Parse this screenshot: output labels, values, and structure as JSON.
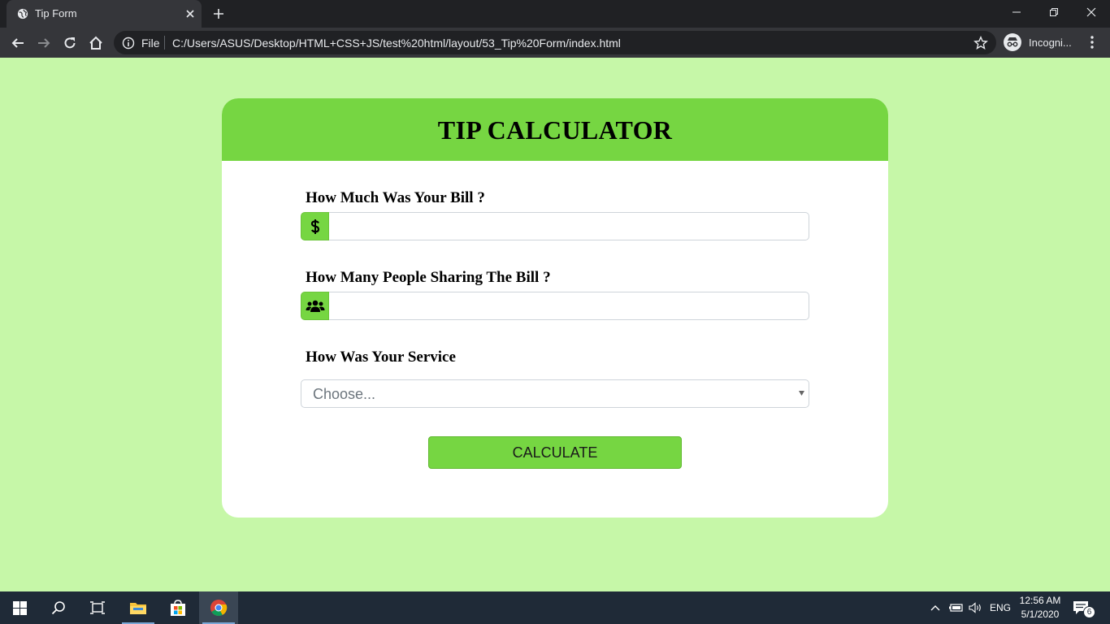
{
  "browser": {
    "tab_title": "Tip Form",
    "url_scheme": "File",
    "url": "C:/Users/ASUS/Desktop/HTML+CSS+JS/test%20html/layout/53_Tip%20Form/index.html",
    "profile_label": "Incogni..."
  },
  "app": {
    "title": "TIP CALCULATOR",
    "bill_label": "How Much Was Your Bill ?",
    "bill_icon": "dollar-icon",
    "bill_value": "",
    "people_label": "How Many People Sharing The Bill ?",
    "people_icon": "users-icon",
    "people_value": "",
    "service_label": "How Was Your Service",
    "service_selected": "Choose...",
    "calculate_label": "CALCULATE"
  },
  "colors": {
    "page_background": "#c6f7a8",
    "accent_green": "#76d642",
    "card_background": "#ffffff"
  },
  "taskbar": {
    "language": "ENG",
    "time": "12:56 AM",
    "date": "5/1/2020",
    "notification_count": "6"
  }
}
